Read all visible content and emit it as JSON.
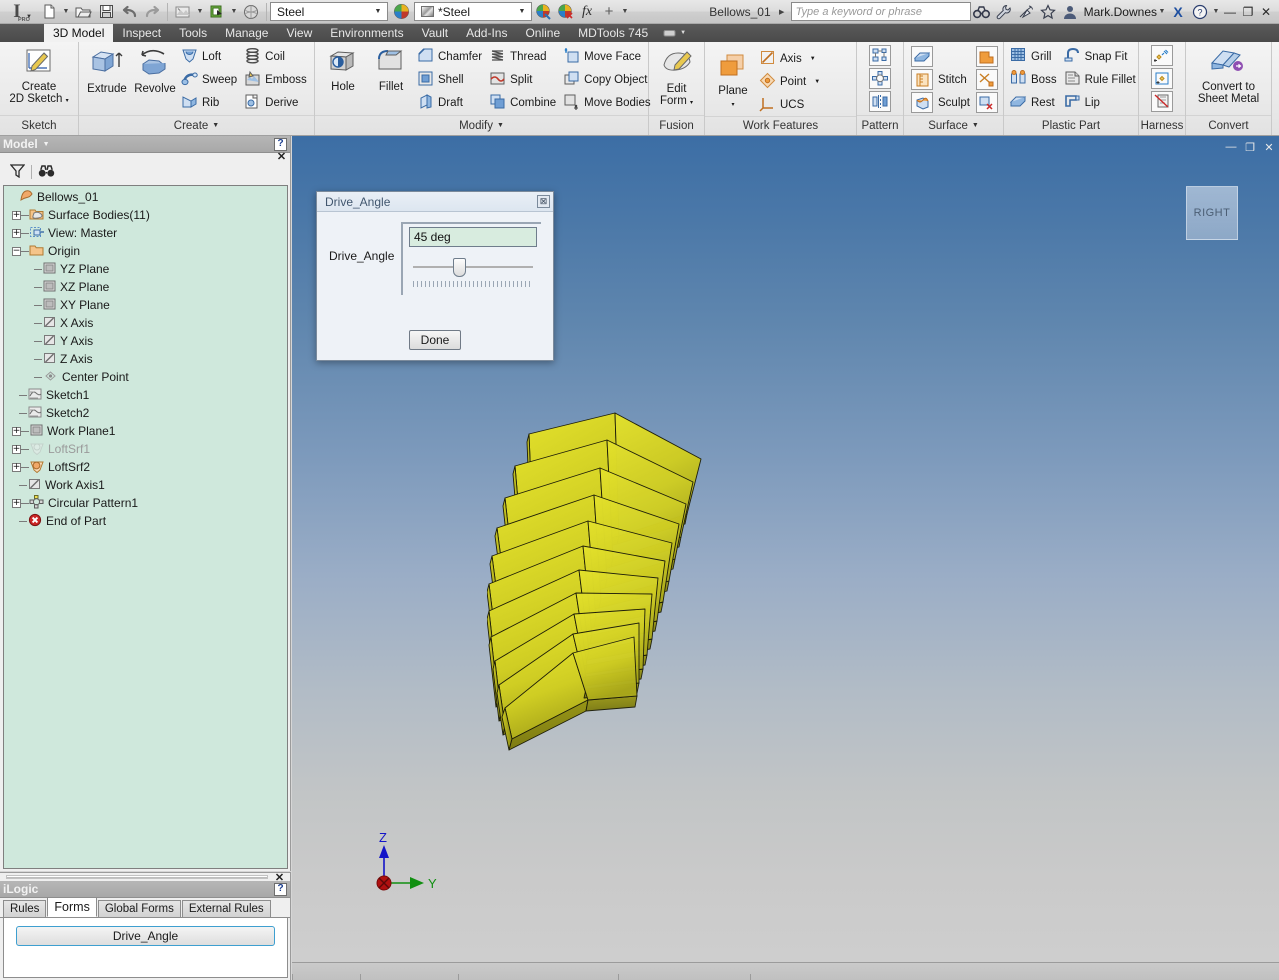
{
  "app": {
    "logo_text": "I",
    "logo_sub": "PRO",
    "document_name": "Bellows_01",
    "user_name": "Mark.Downes"
  },
  "quick_access": {
    "items": [
      {
        "name": "new-file-icon",
        "label": "New"
      },
      {
        "name": "open-file-icon",
        "label": "Open"
      },
      {
        "name": "save-icon",
        "label": "Save"
      },
      {
        "name": "undo-icon",
        "label": "Undo"
      },
      {
        "name": "redo-icon",
        "label": "Redo"
      },
      {
        "name": "update-icon",
        "label": "Update"
      },
      {
        "name": "return-icon",
        "label": "Return"
      },
      {
        "name": "appearance-sphere-icon",
        "label": "Material"
      }
    ],
    "material_value": "Steel",
    "appearance_value": "*Steel",
    "fx_label": "fx",
    "plus_label": "+"
  },
  "search": {
    "placeholder": "Type a keyword or phrase"
  },
  "window_controls": {
    "minimize": "—",
    "restore": "❐",
    "close": "✕"
  },
  "ribbon_tabs": [
    {
      "label": "3D Model",
      "active": true
    },
    {
      "label": "Inspect",
      "active": false
    },
    {
      "label": "Tools",
      "active": false
    },
    {
      "label": "Manage",
      "active": false
    },
    {
      "label": "View",
      "active": false
    },
    {
      "label": "Environments",
      "active": false
    },
    {
      "label": "Vault",
      "active": false
    },
    {
      "label": "Add-Ins",
      "active": false
    },
    {
      "label": "Online",
      "active": false
    },
    {
      "label": "MDTools 745",
      "active": false
    }
  ],
  "ribbon_panels": [
    {
      "title": "Sketch",
      "dropdown": false,
      "big_buttons": [
        {
          "label": "Create\n2D Sketch",
          "line1": "Create",
          "line2": "2D Sketch",
          "icon": "create-2d-sketch-icon",
          "has_arrow": true
        }
      ],
      "small_groups": []
    },
    {
      "title": "Create",
      "dropdown": true,
      "big_buttons": [
        {
          "line1": "Extrude",
          "line2": "",
          "icon": "extrude-icon",
          "has_arrow": false
        },
        {
          "line1": "Revolve",
          "line2": "",
          "icon": "revolve-icon",
          "has_arrow": false
        }
      ],
      "small_groups": [
        [
          {
            "label": "Loft",
            "icon": "loft-icon"
          },
          {
            "label": "Sweep",
            "icon": "sweep-icon"
          },
          {
            "label": "Rib",
            "icon": "rib-icon"
          }
        ],
        [
          {
            "label": "Coil",
            "icon": "coil-icon"
          },
          {
            "label": "Emboss",
            "icon": "emboss-icon"
          },
          {
            "label": "Derive",
            "icon": "derive-icon"
          }
        ]
      ]
    },
    {
      "title": "Modify",
      "dropdown": true,
      "big_buttons": [
        {
          "line1": "Hole",
          "line2": "",
          "icon": "hole-icon",
          "has_arrow": false
        },
        {
          "line1": "Fillet",
          "line2": "",
          "icon": "fillet-icon",
          "has_arrow": false
        }
      ],
      "small_groups": [
        [
          {
            "label": "Chamfer",
            "icon": "chamfer-icon"
          },
          {
            "label": "Shell",
            "icon": "shell-icon"
          },
          {
            "label": "Draft",
            "icon": "draft-icon"
          }
        ],
        [
          {
            "label": "Thread",
            "icon": "thread-icon"
          },
          {
            "label": "Split",
            "icon": "split-icon"
          },
          {
            "label": "Combine",
            "icon": "combine-icon"
          }
        ],
        [
          {
            "label": "Move Face",
            "icon": "move-face-icon"
          },
          {
            "label": "Copy Object",
            "icon": "copy-object-icon"
          },
          {
            "label": "Move Bodies",
            "icon": "move-bodies-icon"
          }
        ]
      ]
    },
    {
      "title": "Fusion",
      "dropdown": false,
      "big_buttons": [
        {
          "line1": "Edit",
          "line2": "Form",
          "icon": "edit-form-icon",
          "has_arrow": true
        }
      ],
      "small_groups": []
    },
    {
      "title": "Work Features",
      "dropdown": false,
      "big_buttons": [
        {
          "line1": "Plane",
          "line2": "",
          "icon": "plane-icon",
          "has_arrow": true
        }
      ],
      "small_groups": [
        [
          {
            "label": "Axis",
            "icon": "axis-icon",
            "arrow": true
          },
          {
            "label": "Point",
            "icon": "point-icon",
            "arrow": true
          },
          {
            "label": "UCS",
            "icon": "ucs-icon",
            "arrow": false
          }
        ]
      ]
    },
    {
      "title": "Pattern",
      "dropdown": false,
      "big_buttons": [],
      "icon_only": [
        "rectangular-pattern-icon",
        "circular-pattern-icon",
        "mirror-icon"
      ]
    },
    {
      "title": "Surface",
      "dropdown": true,
      "big_buttons": [],
      "small_groups": [
        [
          {
            "label": "",
            "icon": "thicken-offset-icon"
          },
          {
            "label": "Stitch",
            "icon": "stitch-icon"
          },
          {
            "label": "Sculpt",
            "icon": "sculpt-icon"
          }
        ],
        [
          {
            "label": "",
            "icon": "patch-icon"
          },
          {
            "label": "",
            "icon": "trim-icon"
          },
          {
            "label": "",
            "icon": "delete-face-icon"
          }
        ]
      ]
    },
    {
      "title": "Plastic Part",
      "dropdown": false,
      "big_buttons": [],
      "small_groups": [
        [
          {
            "label": "Grill",
            "icon": "grill-icon"
          },
          {
            "label": "Boss",
            "icon": "boss-icon"
          },
          {
            "label": "Rest",
            "icon": "rest-icon"
          }
        ],
        [
          {
            "label": "Snap Fit",
            "icon": "snap-fit-icon"
          },
          {
            "label": "Rule Fillet",
            "icon": "rule-fillet-icon"
          },
          {
            "label": "Lip",
            "icon": "lip-icon"
          }
        ]
      ]
    },
    {
      "title": "Harness",
      "dropdown": false,
      "big_buttons": [],
      "icon_only": [
        "create-harness-icon",
        "place-harness-icon",
        "harness-properties-icon"
      ]
    },
    {
      "title": "Convert",
      "dropdown": false,
      "big_buttons": [
        {
          "line1": "Convert to",
          "line2": "Sheet Metal",
          "icon": "convert-sheet-metal-icon",
          "has_arrow": false
        }
      ],
      "small_groups": []
    }
  ],
  "browser": {
    "title": "Model",
    "help_glyph": "?",
    "close_glyph": "✕",
    "tools": [
      {
        "name": "filter-icon",
        "label": "Filter"
      },
      {
        "name": "find-binoculars-icon",
        "label": "Find"
      }
    ],
    "tree": [
      {
        "label": "Bellows_01",
        "depth": 0,
        "expander": "none",
        "icon": "part-document-icon",
        "dim": false
      },
      {
        "label": "Surface Bodies(11)",
        "depth": 1,
        "expander": "+",
        "icon": "surface-bodies-folder-icon",
        "dim": false
      },
      {
        "label": "View: Master",
        "depth": 1,
        "expander": "+",
        "icon": "view-master-icon",
        "dim": false
      },
      {
        "label": "Origin",
        "depth": 1,
        "expander": "-",
        "icon": "origin-folder-icon",
        "dim": false
      },
      {
        "label": "YZ Plane",
        "depth": 2,
        "expander": "none",
        "icon": "work-plane-icon",
        "dim": false
      },
      {
        "label": "XZ Plane",
        "depth": 2,
        "expander": "none",
        "icon": "work-plane-icon",
        "dim": false
      },
      {
        "label": "XY Plane",
        "depth": 2,
        "expander": "none",
        "icon": "work-plane-icon",
        "dim": false
      },
      {
        "label": "X Axis",
        "depth": 2,
        "expander": "none",
        "icon": "work-axis-icon",
        "dim": false
      },
      {
        "label": "Y Axis",
        "depth": 2,
        "expander": "none",
        "icon": "work-axis-icon",
        "dim": false
      },
      {
        "label": "Z Axis",
        "depth": 2,
        "expander": "none",
        "icon": "work-axis-icon",
        "dim": false
      },
      {
        "label": "Center Point",
        "depth": 2,
        "expander": "none",
        "icon": "center-point-icon",
        "dim": false
      },
      {
        "label": "Sketch1",
        "depth": 1,
        "expander": "none",
        "icon": "sketch-icon",
        "dim": false
      },
      {
        "label": "Sketch2",
        "depth": 1,
        "expander": "none",
        "icon": "sketch-icon",
        "dim": false
      },
      {
        "label": "Work Plane1",
        "depth": 1,
        "expander": "+",
        "icon": "work-plane-icon",
        "dim": false
      },
      {
        "label": "LoftSrf1",
        "depth": 1,
        "expander": "+",
        "icon": "loft-surface-icon",
        "dim": true
      },
      {
        "label": "LoftSrf2",
        "depth": 1,
        "expander": "+",
        "icon": "loft-surface-icon",
        "dim": false
      },
      {
        "label": "Work Axis1",
        "depth": 1,
        "expander": "none",
        "icon": "work-axis-icon",
        "dim": false
      },
      {
        "label": "Circular Pattern1",
        "depth": 1,
        "expander": "+",
        "icon": "circular-pattern-icon",
        "dim": false
      },
      {
        "label": "End of Part",
        "depth": 1,
        "expander": "none",
        "icon": "end-of-part-icon",
        "dim": false
      }
    ]
  },
  "ilogic": {
    "title": "iLogic",
    "help_glyph": "?",
    "close_glyph": "✕",
    "tabs": [
      {
        "label": "Rules",
        "active": false
      },
      {
        "label": "Forms",
        "active": true
      },
      {
        "label": "Global Forms",
        "active": false
      },
      {
        "label": "External Rules",
        "active": false
      }
    ],
    "form_buttons": [
      {
        "label": "Drive_Angle"
      }
    ]
  },
  "dialog": {
    "title": "Drive_Angle",
    "close_glyph": "☒",
    "field_label": "Drive_Angle",
    "field_value": "45 deg",
    "slider_percent": 35,
    "done_label": "Done"
  },
  "viewport": {
    "view_cube_label": "RIGHT",
    "triad": {
      "z_label": "Z",
      "y_label": "Y"
    },
    "model_name": "bellows-surface-model",
    "plate_count": 11
  },
  "colors": {
    "model_fill_light": "#d8d623",
    "model_fill_mid": "#c6c41e",
    "model_fill_dark": "#8a8914",
    "accent_blue": "#3c6ea5",
    "tree_bg": "#cfe8dc",
    "field_bg": "#d8ecdf",
    "form_button_border": "#3e9fd0"
  }
}
